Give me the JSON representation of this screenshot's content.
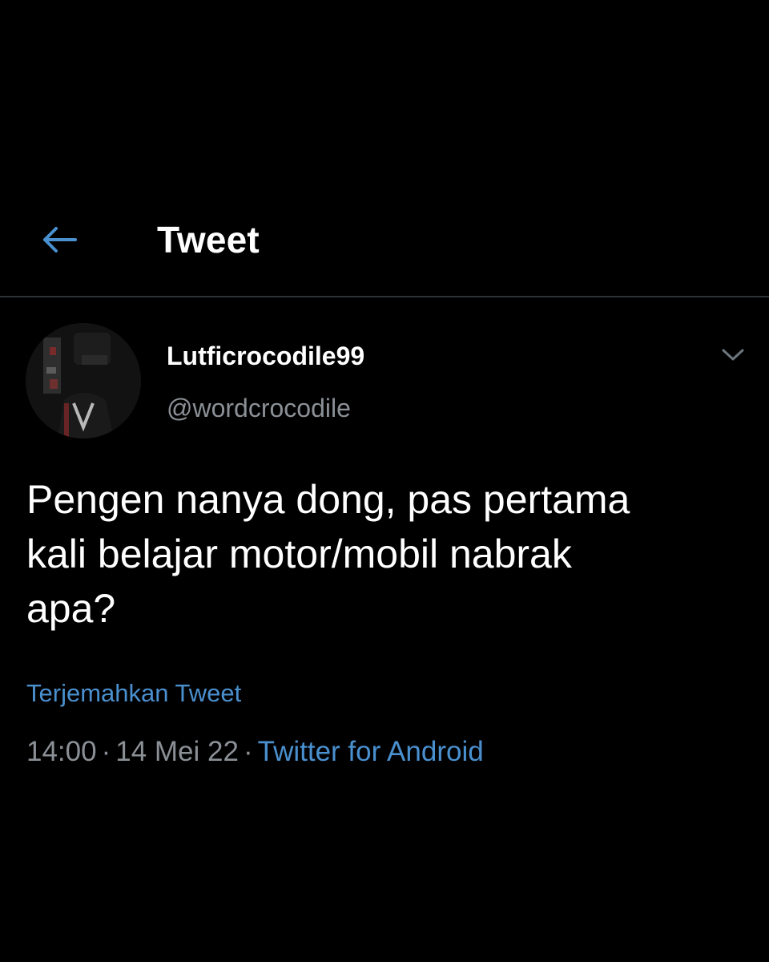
{
  "header": {
    "back_icon": "arrow-left-icon",
    "title": "Tweet"
  },
  "tweet": {
    "author": {
      "display_name": "Lutficrocodile99",
      "handle": "@wordcrocodile"
    },
    "more_icon": "chevron-down-icon",
    "text": "Pengen nanya dong, pas pertama\nkali belajar motor/mobil nabrak\napa?",
    "translate_label": "Terjemahkan Tweet",
    "meta": {
      "time": "14:00",
      "date": "14 Mei 22",
      "separator": "·",
      "source": "Twitter for Android"
    }
  },
  "colors": {
    "background": "#000000",
    "accent": "#4a90cf",
    "muted_text": "#8b9096",
    "divider": "#2f3336"
  }
}
